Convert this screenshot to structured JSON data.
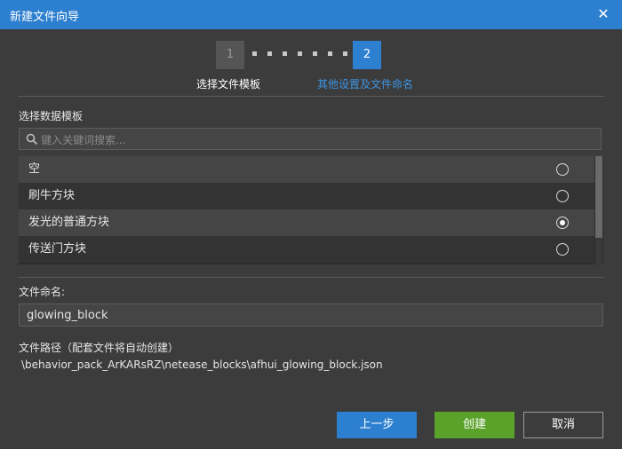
{
  "window": {
    "title": "新建文件向导",
    "close_icon": "close-icon"
  },
  "stepper": {
    "steps": [
      {
        "number": "1",
        "label": "选择文件模板"
      },
      {
        "number": "2",
        "label": "其他设置及文件命名"
      }
    ],
    "active_step": 2
  },
  "template_section": {
    "label": "选择数据模板",
    "search_placeholder": "键入关键词搜索...",
    "options": [
      {
        "label": "空",
        "selected": false
      },
      {
        "label": "刷牛方块",
        "selected": false
      },
      {
        "label": "发光的普通方块",
        "selected": true
      },
      {
        "label": "传送门方块",
        "selected": false
      }
    ]
  },
  "filename_section": {
    "label": "文件命名:",
    "value": "glowing_block"
  },
  "path_section": {
    "label": "文件路径（配套文件将自动创建）",
    "value": "\\behavior_pack_ArKARsRZ\\netease_blocks\\afhui_glowing_block.json"
  },
  "buttons": {
    "prev": "上一步",
    "create": "创建",
    "cancel": "取消"
  },
  "colors": {
    "accent": "#2d7fcf",
    "create": "#5aa22a",
    "background": "#3c3c3c"
  }
}
